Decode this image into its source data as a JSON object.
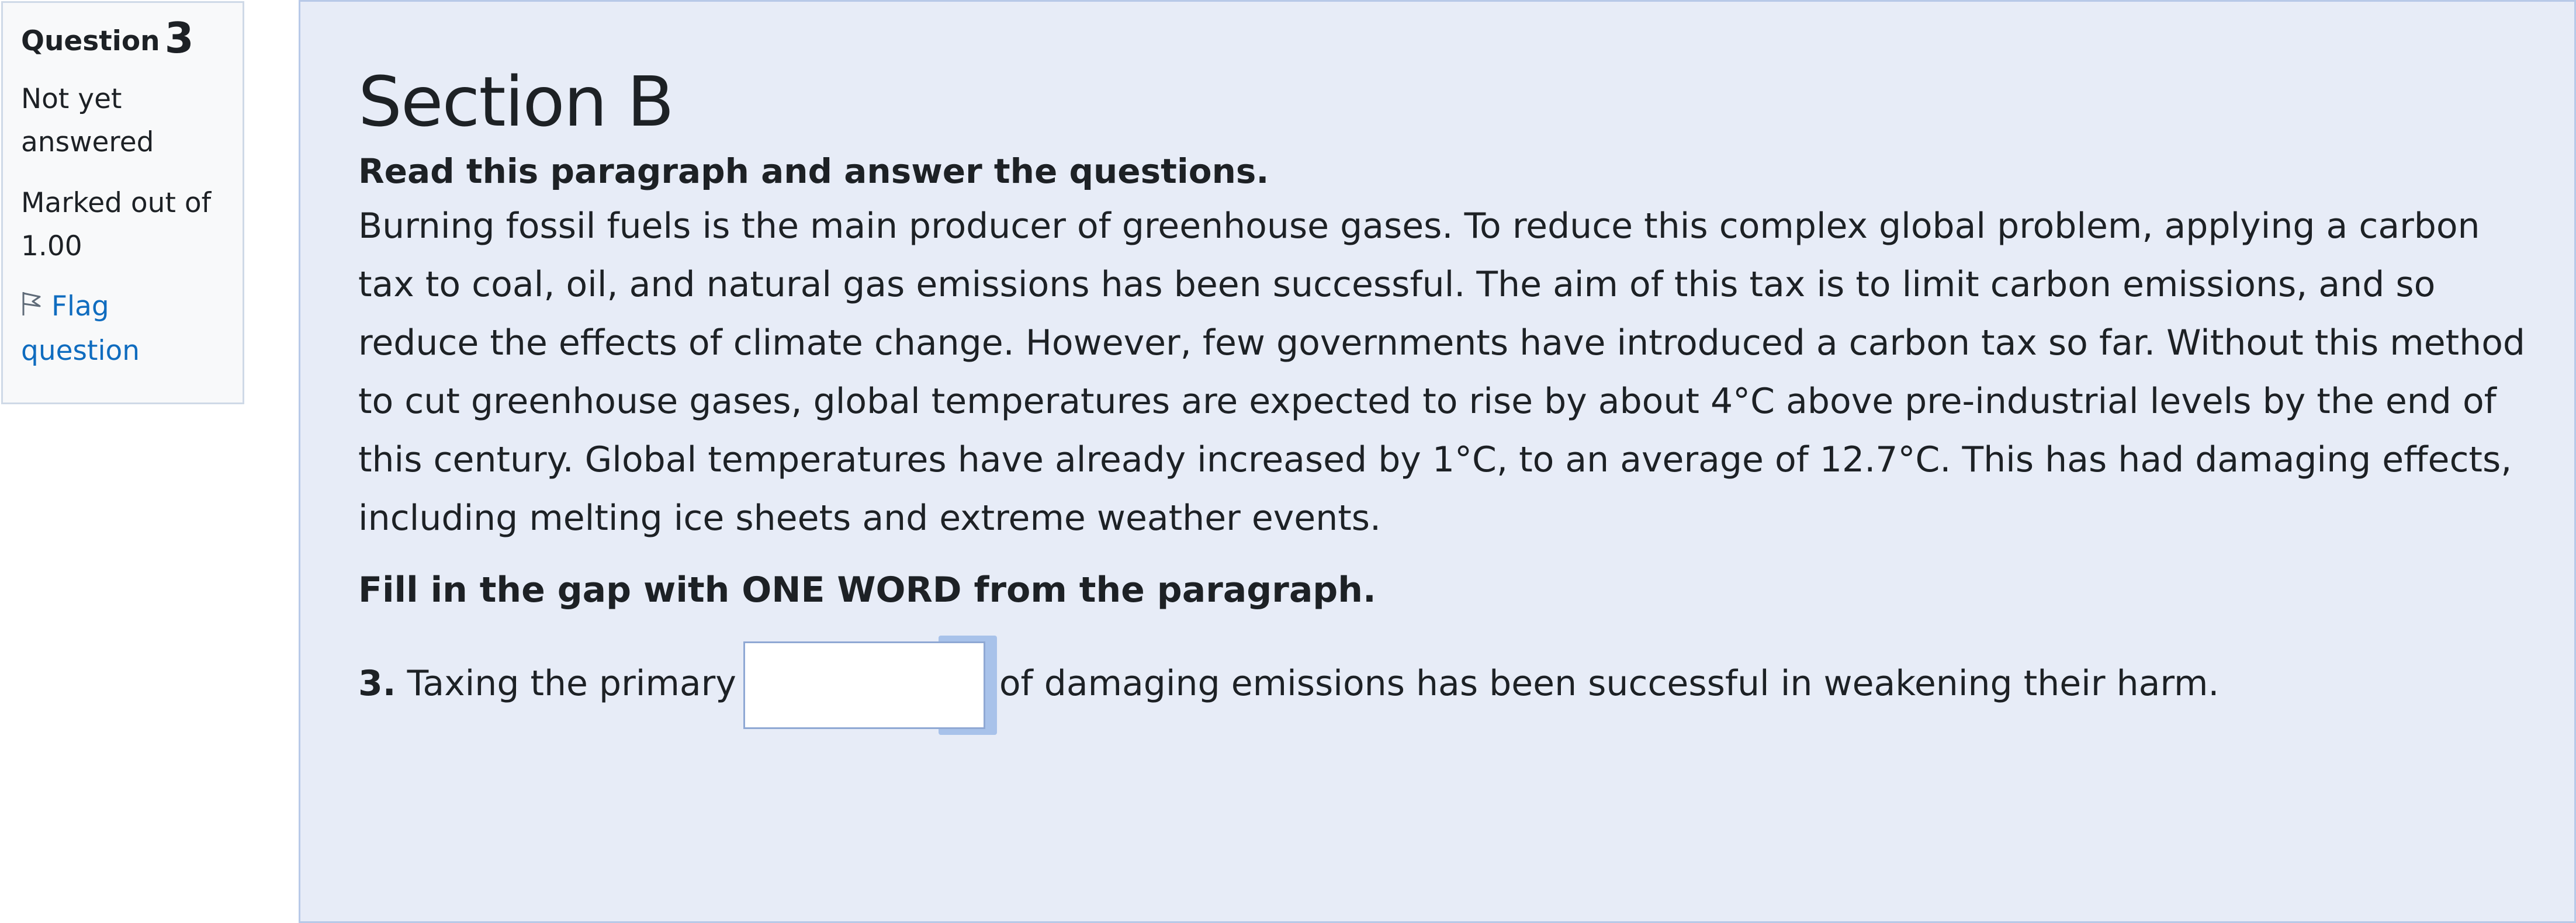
{
  "info": {
    "question_label": "Question",
    "question_number": "3",
    "state": "Not yet answered",
    "grade": "Marked out of 1.00",
    "flag_label": "Flag question"
  },
  "content": {
    "section_title": "Section B",
    "instruction": "Read this paragraph and answer the questions.",
    "paragraph": "Burning fossil fuels is the main producer of greenhouse gases. To reduce this complex global problem, applying a carbon tax to coal, oil, and natural gas emissions has been successful. The aim of this tax is to limit carbon emissions, and so reduce the effects of climate change. However, few governments have introduced a carbon tax so far. Without this method to cut greenhouse gases, global temperatures are expected to rise by about 4°C above pre-industrial levels by the end of this century. Global temperatures have already increased by 1°C, to an average of 12.7°C. This has had damaging effects, including melting ice sheets and extreme weather events.",
    "gap_instruction": "Fill in the gap with ONE WORD from the paragraph.",
    "question": {
      "number": "3.",
      "before_gap": "Taxing the primary",
      "answer_value": "",
      "after_gap": "of damaging emissions has been successful in weakening their harm."
    }
  }
}
